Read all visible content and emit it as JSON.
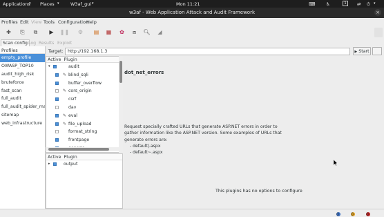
{
  "system_bar": {
    "applications": "Applications",
    "places": "Places",
    "app_menu": "W3af_gui",
    "clock": "Mon 11:21",
    "workspace": "1"
  },
  "window": {
    "title": "w3af - Web Application Attack and Audit Framework"
  },
  "menu": {
    "profiles": "Profiles",
    "edit": "Edit",
    "view": "View",
    "tools": "Tools",
    "configuration": "Configuration",
    "help": "Help"
  },
  "tabs": {
    "scan_config": "Scan config",
    "log": "Log",
    "results": "Results",
    "exploit": "Exploit"
  },
  "profiles": {
    "header": "Profiles",
    "items": [
      "empty_profile",
      "OWASP_TOP10",
      "audit_high_risk",
      "bruteforce",
      "fast_scan",
      "full_audit",
      "full_audit_spider_man",
      "sitemap",
      "web_infrastructure"
    ]
  },
  "target": {
    "label": "Target:",
    "value": "http://192.168.1.3",
    "start": "Start"
  },
  "plugins": {
    "col_active": "Active",
    "col_plugin": "Plugin",
    "group": "audit",
    "items": [
      "blind_sqli",
      "buffer_overflow",
      "cors_origin",
      "csrf",
      "dav",
      "eval",
      "file_upload",
      "format_string",
      "frontpage",
      "generic"
    ]
  },
  "output_plugins": {
    "col_active": "Active",
    "col_plugin": "Plugin",
    "group": "output"
  },
  "detail": {
    "title": "dot_net_errors",
    "description": "Request specially crafted URLs that generate ASP.NET errors in order to\ngather information like the ASP.NET version. Some examples of URLs that\ngenerate errors are:\n    - default|.aspx\n    - default~.aspx",
    "no_options": "This plugins has no options to configure"
  },
  "status": {
    "info_count": "0",
    "warn_count": "0",
    "err_count": "0"
  },
  "colors": {
    "accent": "#4a90d9",
    "topbar": "#1e1e1e",
    "titlebar": "#2b2b2b"
  }
}
